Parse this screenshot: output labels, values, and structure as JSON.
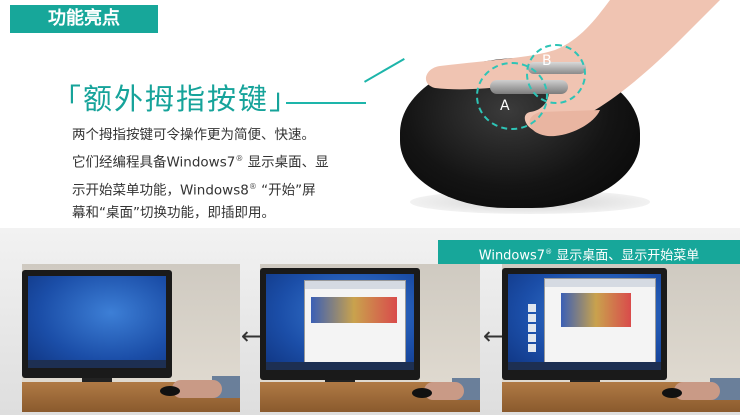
{
  "badge": {
    "label": "功能亮点"
  },
  "feature": {
    "title": "「额外拇指按键」",
    "description_lines": [
      "两个拇指按键可令操作更为简便、快速。",
      "它们经编程具备Windows7",
      " 显示桌面、显",
      "示开始菜单功能，Windows8",
      " “开始”屏",
      "幕和“桌面”切换功能，即插即用。"
    ],
    "registered_mark": "®"
  },
  "mouse": {
    "button_a_label": "A",
    "button_b_label": "B"
  },
  "windows_section": {
    "label_prefix": "Windows7",
    "label_mark": "®",
    "label_suffix": " 显示桌面、显示开始菜单"
  },
  "icons": {
    "arrow": "left-right-arrow-icon"
  },
  "colors": {
    "accent": "#17a79a",
    "title": "#16a39a"
  }
}
